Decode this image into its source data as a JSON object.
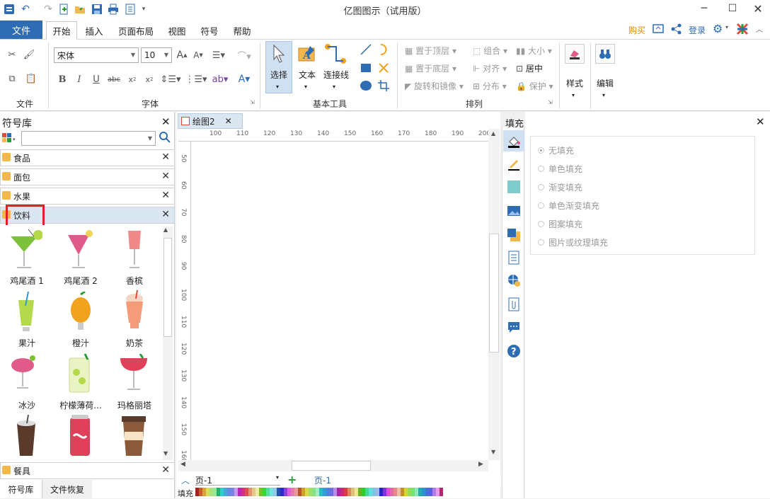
{
  "window": {
    "title": "亿图图示（试用版）"
  },
  "menu": {
    "file": "文件",
    "tabs": [
      "开始",
      "插入",
      "页面布局",
      "视图",
      "符号",
      "帮助"
    ],
    "buy": "购买",
    "login": "登录"
  },
  "ribbon": {
    "groups": {
      "file": "文件",
      "font": "字体",
      "basic_tools": "基本工具",
      "arrange": "排列"
    },
    "font_name": "宋体",
    "font_size": "10",
    "tools": {
      "select": "选择",
      "text": "文本",
      "connector": "连接线"
    },
    "arrange": {
      "bring_front": "置于顶层",
      "send_back": "置于底层",
      "rotate": "旋转和镜像",
      "group": "组合",
      "align": "对齐",
      "distribute": "分布",
      "size": "大小",
      "center": "居中",
      "protect": "保护"
    },
    "style": "样式",
    "edit": "编辑"
  },
  "library": {
    "title": "符号库",
    "categories": [
      "食品",
      "面包",
      "水果",
      "饮料"
    ],
    "bottom_category": "餐具",
    "symbols": [
      "鸡尾酒 1",
      "鸡尾酒 2",
      "香槟",
      "果汁",
      "橙汁",
      "奶茶",
      "冰沙",
      "柠檬薄荷...",
      "玛格丽塔"
    ],
    "tabs": [
      "符号库",
      "文件恢复"
    ]
  },
  "canvas": {
    "tab": "绘图2",
    "hruler": [
      "100",
      "110",
      "120",
      "130",
      "140",
      "150",
      "160",
      "170",
      "180",
      "190",
      "200"
    ],
    "vruler": [
      "50",
      "60",
      "70",
      "80",
      "90",
      "100",
      "110",
      "120",
      "130",
      "140",
      "150",
      "160"
    ],
    "page_select": "页-1",
    "page_tab": "页-1",
    "fill_label": "填充"
  },
  "fill": {
    "title": "填充",
    "options": [
      "无填充",
      "单色填充",
      "渐变填充",
      "单色渐变填充",
      "图案填充",
      "图片或纹理填充"
    ],
    "selected": "无填充"
  },
  "colors": {
    "accent": "#2e6db4",
    "buy": "#e8870e",
    "highlight": "#e0202a"
  }
}
